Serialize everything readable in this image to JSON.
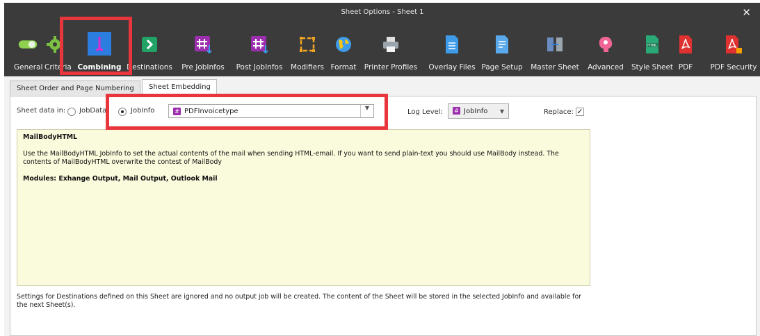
{
  "window": {
    "title": "Sheet Options - Sheet 1",
    "close_glyph": "✕"
  },
  "toolbar": {
    "items": [
      {
        "label": "General",
        "icon": "toggle-icon",
        "color": "#8fd14f"
      },
      {
        "label": "Criteria",
        "icon": "gear-icon",
        "color": "#7cc043"
      },
      {
        "label": "Combining",
        "icon": "combining-icon",
        "color": "#2b7de0"
      },
      {
        "label": "Destinations",
        "icon": "arrow-right-icon",
        "color": "#21a366"
      },
      {
        "label": "Pre JobInfos",
        "icon": "hash-icon",
        "color": "#9b2fae"
      },
      {
        "label": "Post JobInfos",
        "icon": "hash-icon",
        "color": "#9b2fae"
      },
      {
        "label": "Modifiers",
        "icon": "modifiers-icon",
        "color": "#f5a623"
      },
      {
        "label": "Format",
        "icon": "globe-icon",
        "color": "#f5c518"
      },
      {
        "label": "Printer Profiles",
        "icon": "printer-icon",
        "color": "#d0d0d0"
      },
      {
        "label": "Overlay Files",
        "icon": "document-icon",
        "color": "#3e9be9"
      },
      {
        "label": "Page Setup",
        "icon": "page-setup-icon",
        "color": "#5aa9ec"
      },
      {
        "label": "Master Sheet",
        "icon": "master-sheet-icon",
        "color": "#4f7fb5"
      },
      {
        "label": "Advanced",
        "icon": "brain-icon",
        "color": "#f06595"
      },
      {
        "label": "Style Sheet",
        "icon": "html-icon",
        "color": "#2aa876"
      },
      {
        "label": "PDF",
        "icon": "pdf-icon",
        "color": "#e03131"
      },
      {
        "label": "PDF Security",
        "icon": "pdf-security-icon",
        "color": "#e03131"
      }
    ],
    "active": "Combining"
  },
  "tabs": [
    {
      "label": "Sheet Order and Page Numbering"
    },
    {
      "label": "Sheet Embedding"
    }
  ],
  "form": {
    "sheet_data_label": "Sheet data in:",
    "option_jobdata": "JobData",
    "option_jobinfo": "JobInfo",
    "selected_option": "JobInfo",
    "jobinfo_value": "PDFInvoicetype",
    "log_level_label": "Log Level:",
    "log_level_value": "JobInfo",
    "replace_label": "Replace:",
    "replace_checked": true
  },
  "help": {
    "title": "MailBodyHTML",
    "body": "Use the MailBodyHTML JobInfo to set the actual contents of the mail when sending HTML-email. If you want to send plain-text you should use MailBody instead. The contents of MailBodyHTML overwrite the contest of MailBody",
    "modules": "Modules: Exhange Output, Mail Output, Outlook Mail"
  },
  "footer_note": "Settings for Destinations defined on this Sheet are ignored and no output job will be created. The content of the Sheet will be stored in the selected JobInfo and available for the next Sheet(s)."
}
